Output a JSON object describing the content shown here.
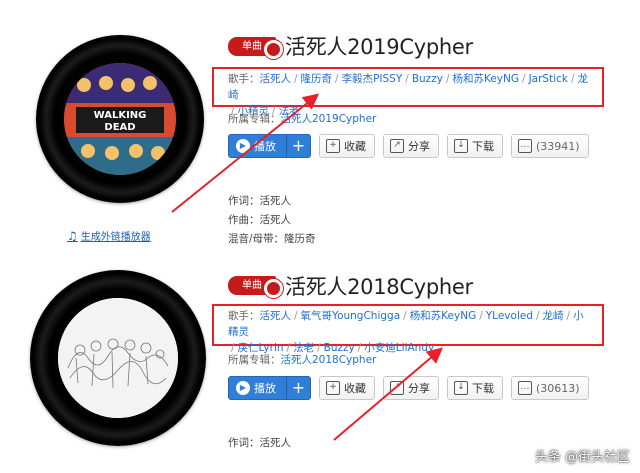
{
  "song1": {
    "badge": "单曲",
    "title": "活死人2019Cypher",
    "singers_label": "歌手：",
    "singers": [
      "活死人",
      "隆历奇",
      "李毅杰PISSY",
      "Buzzy",
      "杨和苏KeyNG",
      "JarStick",
      "龙崎",
      "小精灵",
      "法老"
    ],
    "album_label": "所属专辑：",
    "album": "活死人2019Cypher",
    "buttons": {
      "play": "播放",
      "plus": "+",
      "collect": "收藏",
      "share": "分享",
      "download": "下载",
      "comment_count": "(33941)"
    },
    "credits": [
      "作词：活死人",
      "作曲：活死人",
      "混音/母带：隆历奇"
    ],
    "gen_link": "生成外链播放器",
    "cover_text": [
      "WALKING",
      "DEAD"
    ]
  },
  "song2": {
    "badge": "单曲",
    "title": "活死人2018Cypher",
    "singers_label": "歌手：",
    "singers": [
      "活死人",
      "氧气哥YoungChigga",
      "杨和苏KeyNG",
      "YLevoled",
      "龙崎",
      "小精灵",
      "戾仁Lyrin",
      "法老",
      "Buzzy",
      "小安迪LilAndy"
    ],
    "album_label": "所属专辑：",
    "album": "活死人2018Cypher",
    "buttons": {
      "play": "播放",
      "plus": "+",
      "collect": "收藏",
      "share": "分享",
      "download": "下载",
      "comment_count": "(30613)"
    },
    "credits": [
      "作词：活死人"
    ]
  },
  "watermark": "头条 @街头社区",
  "colors": {
    "accent_red": "#e8202a",
    "link_blue": "#1e6fd1",
    "play_blue": "#2f7ed8"
  },
  "icons": [
    "music-note-icon",
    "play-icon",
    "collect-icon",
    "share-icon",
    "download-icon",
    "comment-icon"
  ]
}
